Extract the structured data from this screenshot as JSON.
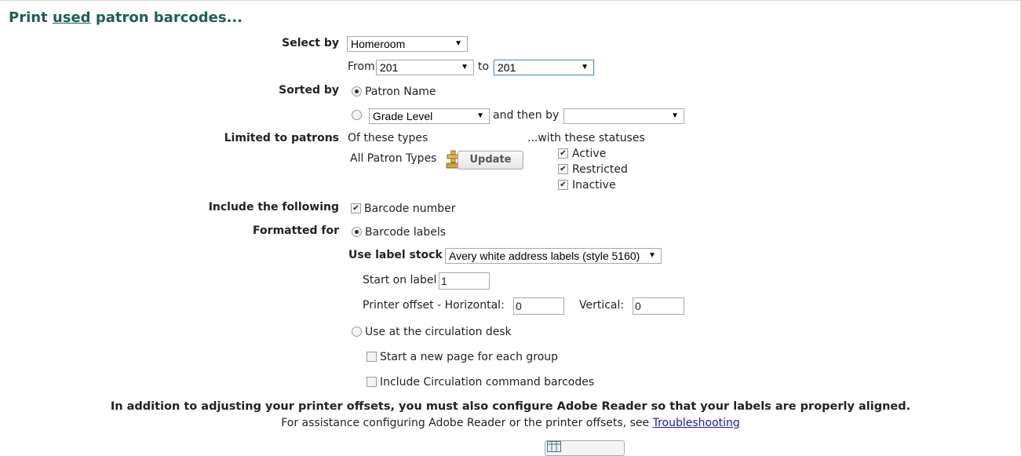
{
  "title": {
    "prefix": "Print ",
    "used": "used",
    "suffix": " patron barcodes..."
  },
  "select_by": {
    "label": "Select by",
    "value": "Homeroom"
  },
  "range": {
    "from_label": "From",
    "from_value": "201",
    "to_label": "to",
    "to_value": "201"
  },
  "sorted_by": {
    "label": "Sorted by",
    "option1": "Patron Name",
    "option2_select": "Grade Level",
    "then_by_label": "and then by",
    "then_by_value": ""
  },
  "limited": {
    "label": "Limited to patrons",
    "types_header": "Of these types",
    "types_value": "All Patron Types",
    "update_button": "Update",
    "statuses_header": "...with these statuses",
    "statuses": [
      "Active",
      "Restricted",
      "Inactive"
    ]
  },
  "include": {
    "label": "Include the following",
    "barcode_number": "Barcode number"
  },
  "formatted": {
    "label": "Formatted for",
    "barcode_labels": "Barcode labels",
    "label_stock_label": "Use label stock",
    "label_stock_value": "Avery white address labels (style 5160)",
    "start_on_label": "Start on label",
    "start_on_value": "1",
    "offset_h_label": "Printer offset - Horizontal:",
    "offset_h_value": "0",
    "offset_v_label": "Vertical:",
    "offset_v_value": "0",
    "circ_desk": "Use at the circulation desk",
    "new_page": "Start a new page for each group",
    "circ_commands": "Include Circulation command barcodes"
  },
  "notice": {
    "bold": "In addition to adjusting your printer offsets, you must also configure Adobe Reader so that your labels are properly aligned.",
    "assist": "For assistance configuring Adobe Reader or the printer offsets, see ",
    "link": "Troubleshooting"
  }
}
